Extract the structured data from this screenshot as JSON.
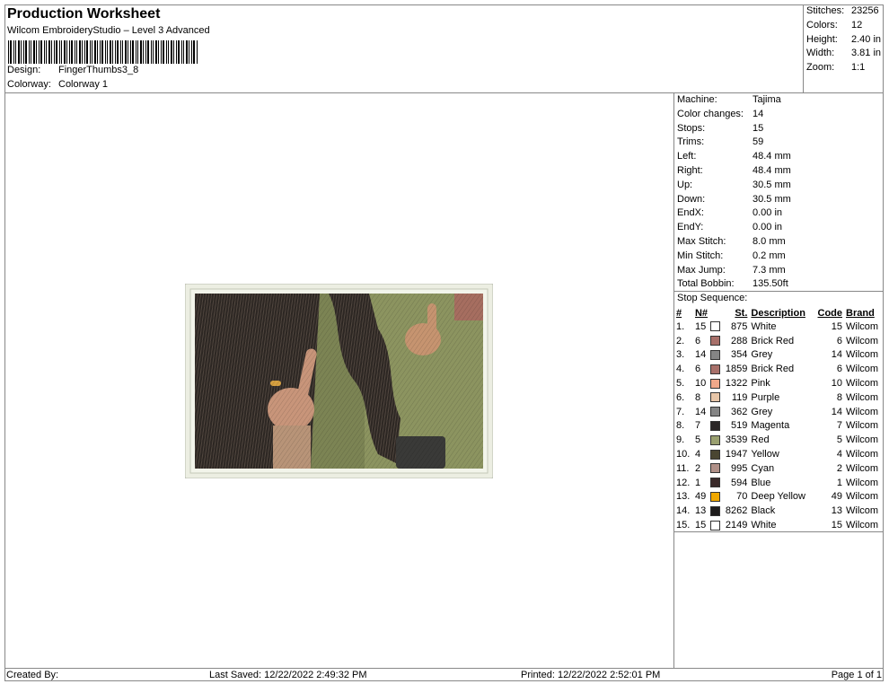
{
  "header": {
    "title": "Production Worksheet",
    "subtitle": "Wilcom EmbroideryStudio – Level 3 Advanced",
    "design_label": "Design:",
    "design_value": "FingerThumbs3_8",
    "colorway_label": "Colorway:",
    "colorway_value": "Colorway 1"
  },
  "summary": {
    "stitches_label": "Stitches:",
    "stitches_value": "23256",
    "colors_label": "Colors:",
    "colors_value": "12",
    "height_label": "Height:",
    "height_value": "2.40 in",
    "width_label": "Width:",
    "width_value": "3.81 in",
    "zoom_label": "Zoom:",
    "zoom_value": "1:1"
  },
  "machine": [
    {
      "k": "Machine:",
      "v": "Tajima"
    },
    {
      "k": "Color changes:",
      "v": "14"
    },
    {
      "k": "Stops:",
      "v": "15"
    },
    {
      "k": "Trims:",
      "v": "59"
    },
    {
      "k": "Left:",
      "v": "48.4 mm"
    },
    {
      "k": "Right:",
      "v": "48.4 mm"
    },
    {
      "k": "Up:",
      "v": "30.5 mm"
    },
    {
      "k": "Down:",
      "v": "30.5 mm"
    },
    {
      "k": "EndX:",
      "v": "0.00 in"
    },
    {
      "k": "EndY:",
      "v": "0.00 in"
    },
    {
      "k": "Max Stitch:",
      "v": "8.0 mm"
    },
    {
      "k": "Min Stitch:",
      "v": "0.2 mm"
    },
    {
      "k": "Max Jump:",
      "v": "7.3 mm"
    },
    {
      "k": "Total Bobbin:",
      "v": "135.50ft"
    }
  ],
  "stop_sequence_label": "Stop Sequence:",
  "stop_headers": {
    "num": "#",
    "n": "N#",
    "st": "St.",
    "desc": "Description",
    "code": "Code",
    "brand": "Brand"
  },
  "stops": [
    {
      "num": "1.",
      "n": "15",
      "color": "#ffffff",
      "st": "875",
      "desc": "White",
      "code": "15",
      "brand": "Wilcom"
    },
    {
      "num": "2.",
      "n": "6",
      "color": "#a8706a",
      "st": "288",
      "desc": "Brick Red",
      "code": "6",
      "brand": "Wilcom"
    },
    {
      "num": "3.",
      "n": "14",
      "color": "#858585",
      "st": "354",
      "desc": "Grey",
      "code": "14",
      "brand": "Wilcom"
    },
    {
      "num": "4.",
      "n": "6",
      "color": "#a8706a",
      "st": "1859",
      "desc": "Brick Red",
      "code": "6",
      "brand": "Wilcom"
    },
    {
      "num": "5.",
      "n": "10",
      "color": "#f0a88a",
      "st": "1322",
      "desc": "Pink",
      "code": "10",
      "brand": "Wilcom"
    },
    {
      "num": "6.",
      "n": "8",
      "color": "#e8c6a8",
      "st": "119",
      "desc": "Purple",
      "code": "8",
      "brand": "Wilcom"
    },
    {
      "num": "7.",
      "n": "14",
      "color": "#858585",
      "st": "362",
      "desc": "Grey",
      "code": "14",
      "brand": "Wilcom"
    },
    {
      "num": "8.",
      "n": "7",
      "color": "#2a2626",
      "st": "519",
      "desc": "Magenta",
      "code": "7",
      "brand": "Wilcom"
    },
    {
      "num": "9.",
      "n": "5",
      "color": "#9aa070",
      "st": "3539",
      "desc": "Red",
      "code": "5",
      "brand": "Wilcom"
    },
    {
      "num": "10.",
      "n": "4",
      "color": "#4a4632",
      "st": "1947",
      "desc": "Yellow",
      "code": "4",
      "brand": "Wilcom"
    },
    {
      "num": "11.",
      "n": "2",
      "color": "#b09088",
      "st": "995",
      "desc": "Cyan",
      "code": "2",
      "brand": "Wilcom"
    },
    {
      "num": "12.",
      "n": "1",
      "color": "#3a2a2a",
      "st": "594",
      "desc": "Blue",
      "code": "1",
      "brand": "Wilcom"
    },
    {
      "num": "13.",
      "n": "49",
      "color": "#f0a800",
      "st": "70",
      "desc": "Deep Yellow",
      "code": "49",
      "brand": "Wilcom"
    },
    {
      "num": "14.",
      "n": "13",
      "color": "#1e1c1c",
      "st": "8262",
      "desc": "Black",
      "code": "13",
      "brand": "Wilcom"
    },
    {
      "num": "15.",
      "n": "15",
      "color": "#ffffff",
      "st": "2149",
      "desc": "White",
      "code": "15",
      "brand": "Wilcom"
    }
  ],
  "footer": {
    "created_by": "Created By:",
    "last_saved": "Last Saved: 12/22/2022 2:49:32 PM",
    "printed": "Printed: 12/22/2022 2:52:01 PM",
    "page": "Page 1 of 1"
  }
}
